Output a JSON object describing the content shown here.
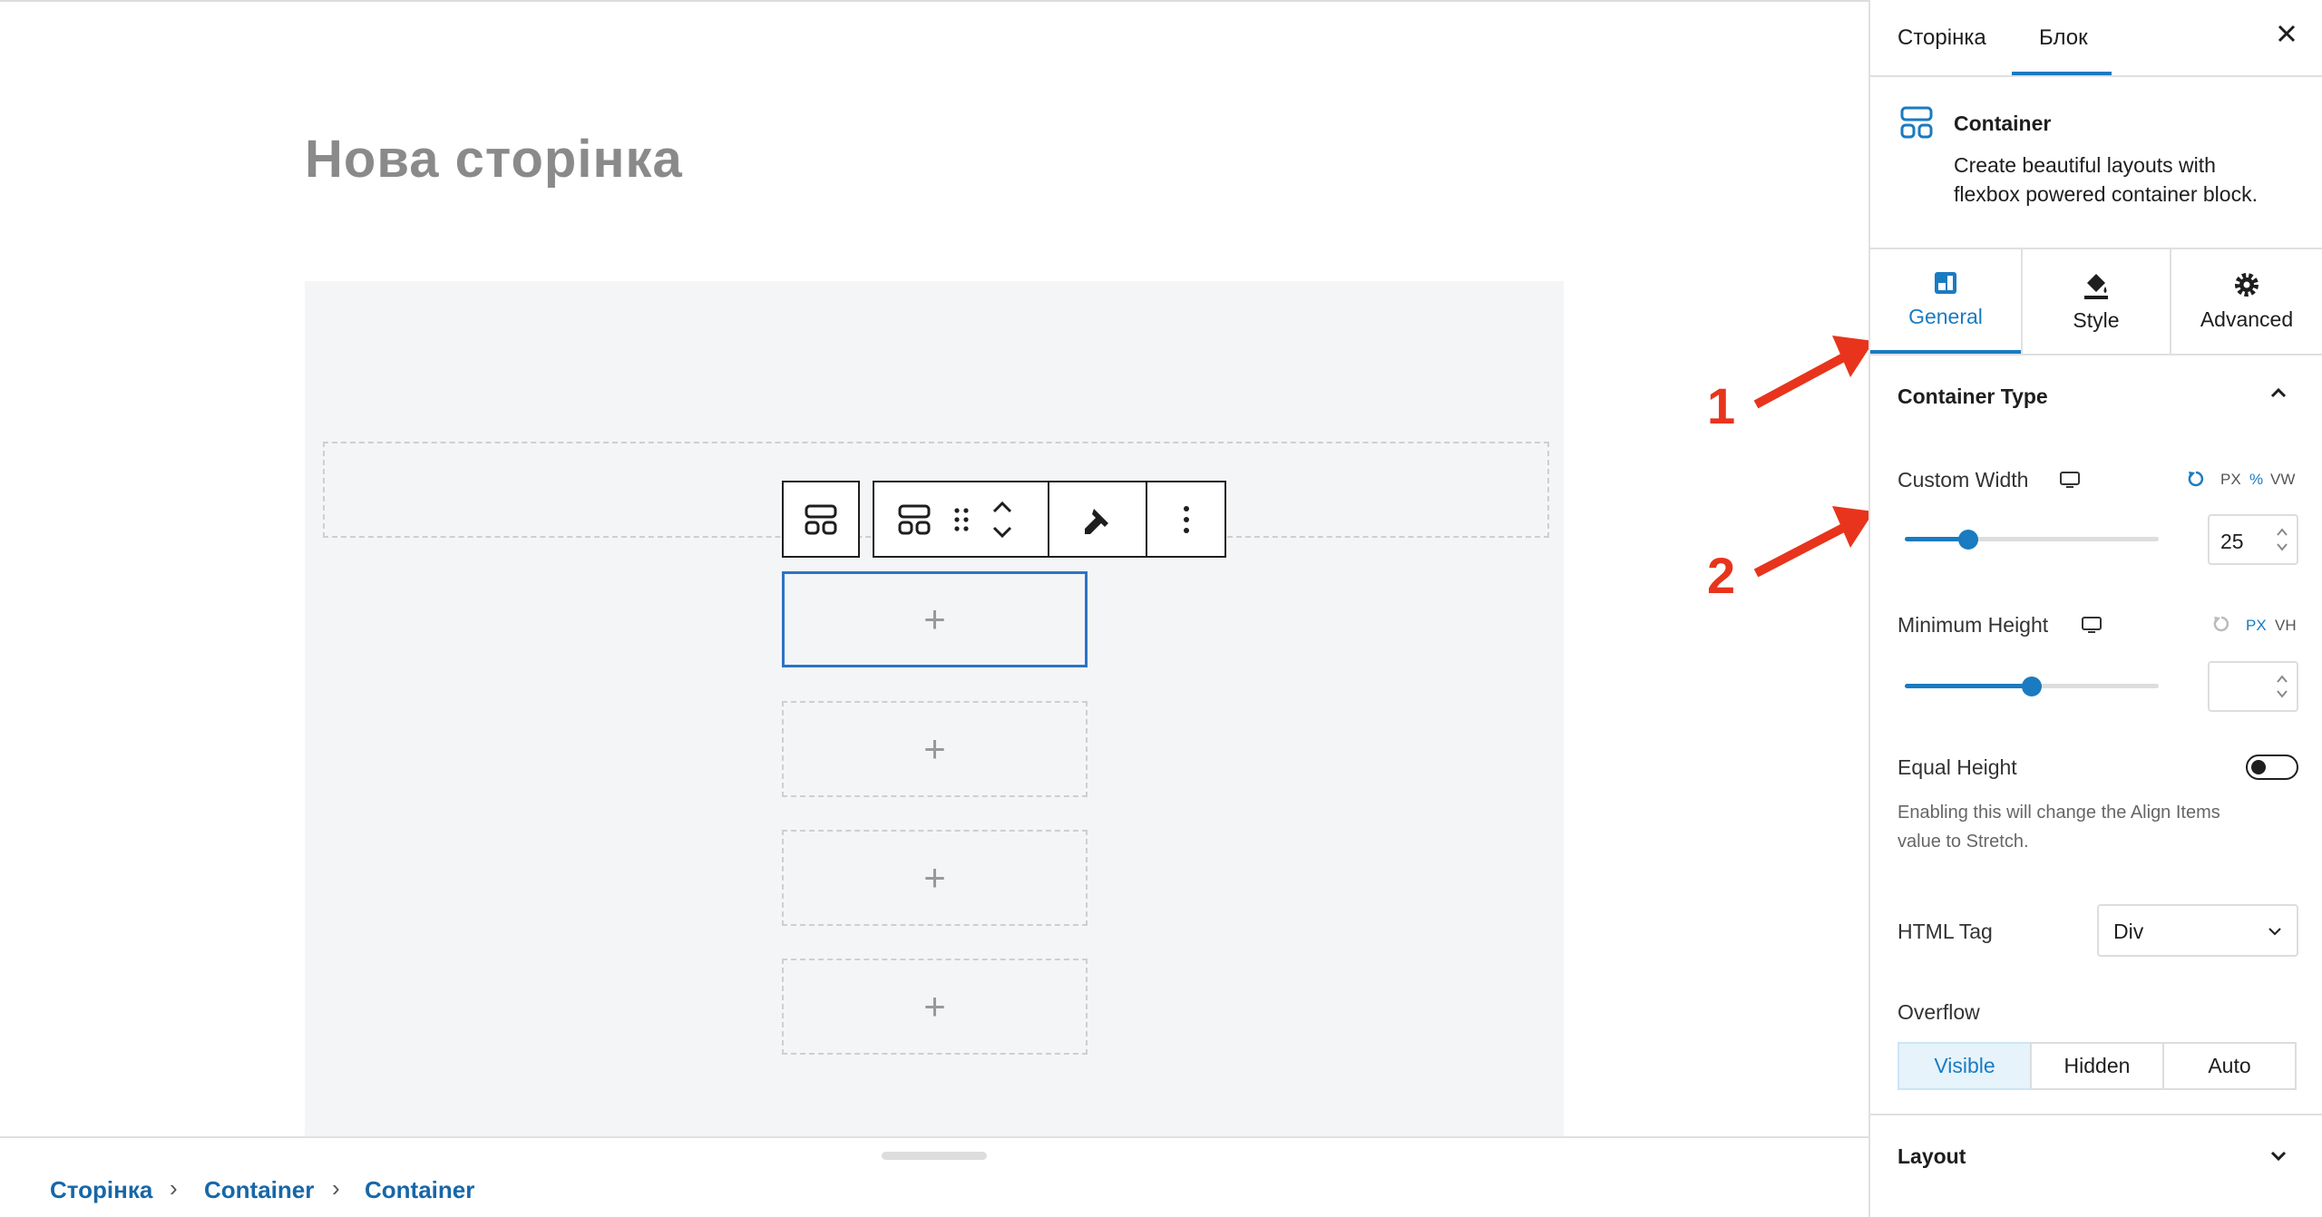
{
  "editor": {
    "page_title": "Нова сторінка",
    "add_symbol": "+"
  },
  "breadcrumb": {
    "items": [
      "Сторінка",
      "Container",
      "Container"
    ],
    "separator": "›"
  },
  "sidebar": {
    "tabs": [
      "Сторінка",
      "Блок"
    ],
    "active_tab": "Блок",
    "close_icon": "close-icon",
    "block": {
      "name": "Container",
      "description_line1": "Create beautiful layouts with",
      "description_line2": "flexbox powered container block."
    },
    "panel_tabs": [
      {
        "label": "General",
        "icon": "layout-icon"
      },
      {
        "label": "Style",
        "icon": "paint-bucket-icon"
      },
      {
        "label": "Advanced",
        "icon": "gear-icon"
      }
    ],
    "active_panel_tab": "General",
    "container_type": {
      "title": "Container Type",
      "custom_width": {
        "label": "Custom Width",
        "units": [
          "PX",
          "%",
          "VW"
        ],
        "active_unit": "%",
        "value": "25",
        "slider_level": 0.25
      },
      "minimum_height": {
        "label": "Minimum Height",
        "units": [
          "PX",
          "VH"
        ],
        "active_unit": "PX",
        "value": "",
        "slider_level": 0.5
      },
      "equal_height": {
        "label": "Equal Height",
        "enabled": false,
        "help_line1": "Enabling this will change the Align Items",
        "help_line2": "value to Stretch."
      },
      "html_tag": {
        "label": "HTML Tag",
        "selected": "Div"
      },
      "overflow": {
        "label": "Overflow",
        "options": [
          "Visible",
          "Hidden",
          "Auto"
        ],
        "selected": "Visible"
      }
    },
    "layout_section": "Layout"
  },
  "annotations": [
    "1",
    "2"
  ],
  "colors": {
    "accent": "#1a7bc1",
    "annotation": "#e8341c",
    "link": "#1767a8"
  }
}
